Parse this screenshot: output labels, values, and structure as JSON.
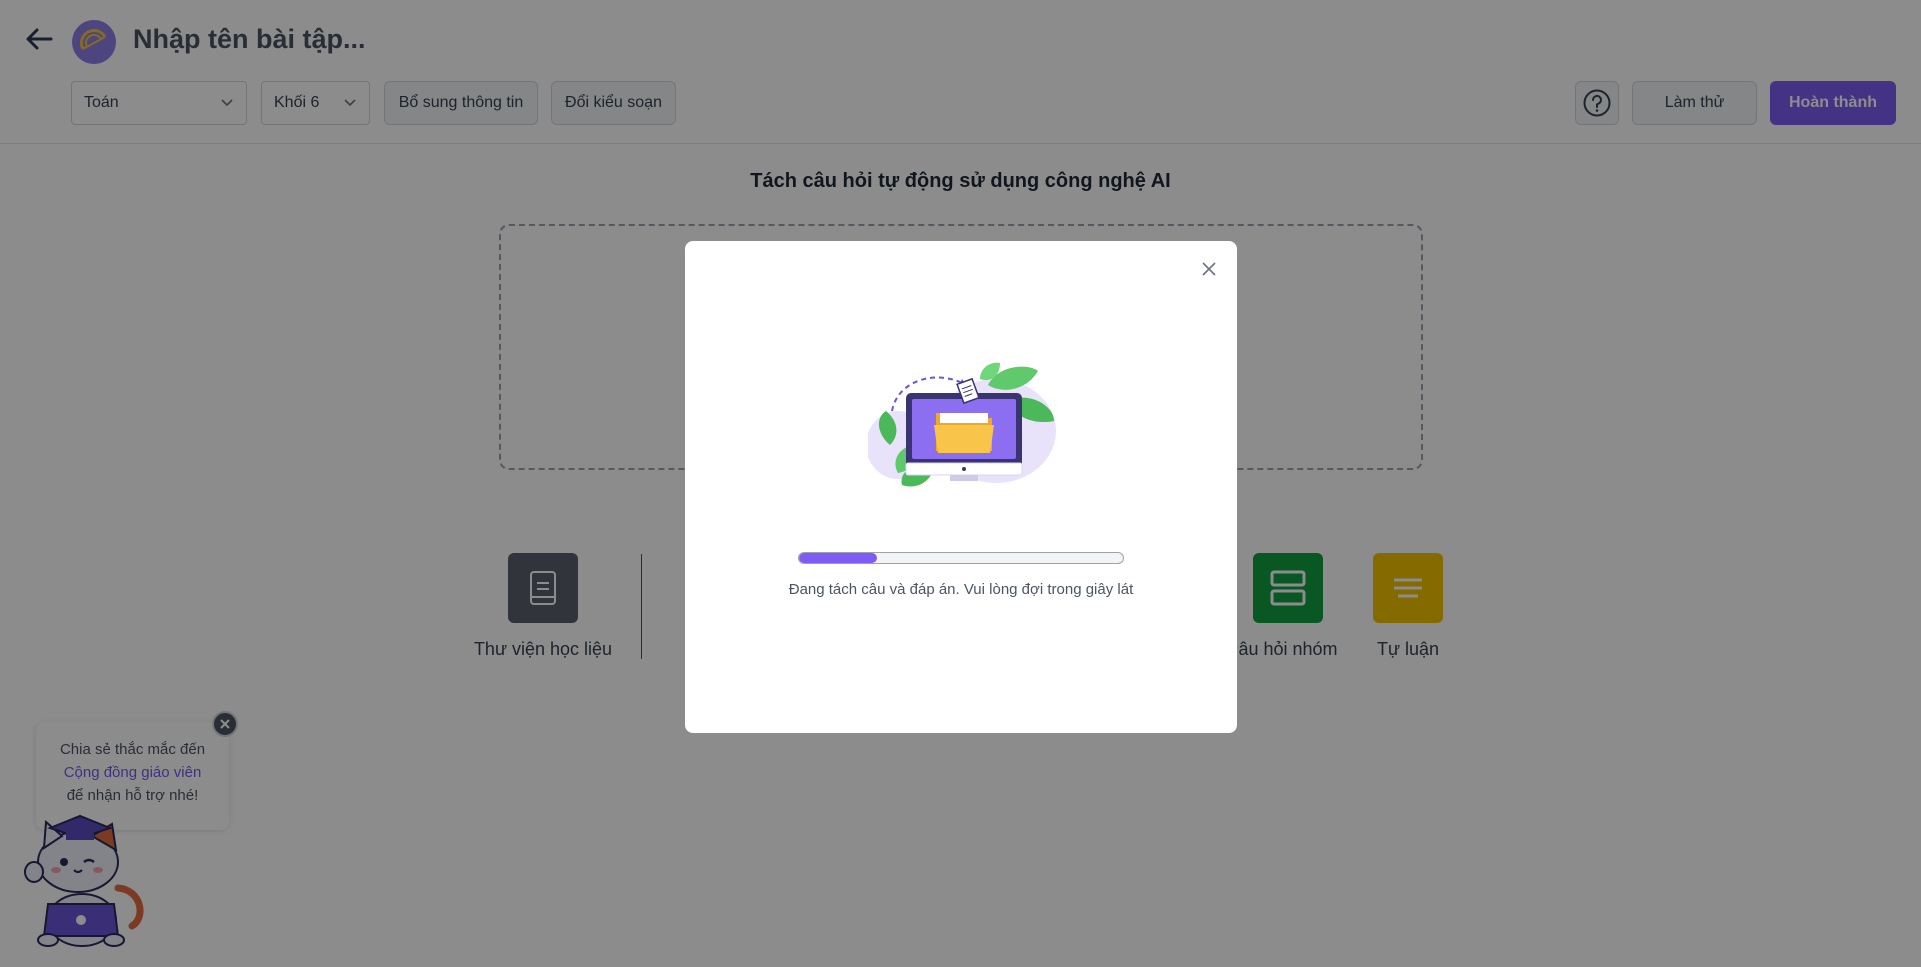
{
  "header": {
    "title": "Nhập tên bài tập...",
    "subject_value": "Toán",
    "grade_value": "Khối 6",
    "more_info_label": "Bổ sung thông tin",
    "change_style_label": "Đổi kiểu soạn",
    "try_label": "Làm thử",
    "done_label": "Hoàn thành"
  },
  "main": {
    "title": "Tách câu hỏi tự động sử dụng công nghệ AI",
    "tools": [
      {
        "label": "Thư viện học liệu"
      },
      {
        "label": "âu hỏi nhóm"
      },
      {
        "label": "Tự luận"
      }
    ]
  },
  "support": {
    "line1": "Chia sẻ thắc mắc đến",
    "link": "Cộng đồng giáo viên",
    "line3": "để nhận hỗ trợ nhé!"
  },
  "modal": {
    "progress_text": "Đang tách câu và đáp án. Vui lòng đợi trong giây lát",
    "progress_fraction": 0.24
  },
  "colors": {
    "accent": "#7c5cf2",
    "group_tile": "#11a140",
    "essay_tile": "#f2c100",
    "library_tile": "#5a5f6b"
  },
  "icons": [
    "arrow-left-icon",
    "protractor-logo-icon",
    "chevron-down-icon",
    "help-circle-icon",
    "book-icon",
    "group-question-icon",
    "essay-lines-icon",
    "close-icon",
    "folder-monitor-illustration",
    "cat-mascot"
  ]
}
